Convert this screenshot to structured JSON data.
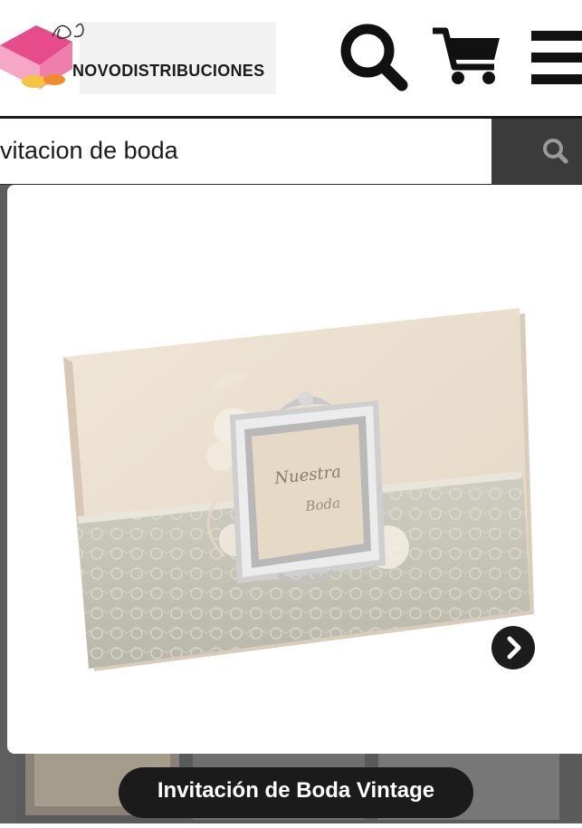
{
  "header": {
    "logo_text": "NOVODISTRIBUCIONES",
    "icons": [
      "search-icon",
      "cart-icon",
      "hamburger-menu-icon"
    ]
  },
  "search": {
    "value": "vitacion de boda",
    "submit_icon": "search-icon"
  },
  "lightbox": {
    "caption": "Invitación de Boda Vintage",
    "next_icon": "chevron-right-icon",
    "card_script": [
      "Nuestra",
      "Boda"
    ]
  },
  "colors": {
    "header_bg": "#ffffff",
    "search_submit_bg": "#3b3b3b",
    "backdrop": "#5e5e5e",
    "caption_bg": "#1b1b1b",
    "card_cream": "#ebe0d1",
    "card_band": "#c7c5b8"
  }
}
